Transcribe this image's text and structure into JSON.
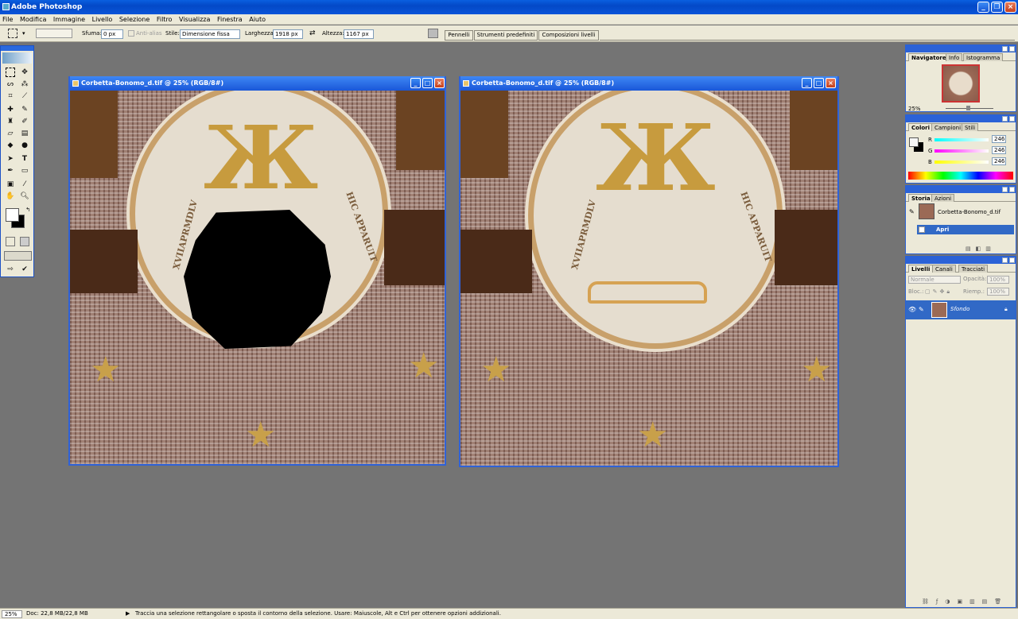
{
  "app": {
    "title": "Adobe Photoshop"
  },
  "menu": [
    "File",
    "Modifica",
    "Immagine",
    "Livello",
    "Selezione",
    "Filtro",
    "Visualizza",
    "Finestra",
    "Aiuto"
  ],
  "options": {
    "feather_label": "Sfuma:",
    "feather_value": "0 px",
    "antialias_label": "Anti-alias",
    "style_label": "Stile:",
    "style_value": "Dimensione fissa",
    "width_label": "Larghezza:",
    "width_value": "1918 px",
    "height_label": "Altezza:",
    "height_value": "1167 px",
    "palette_tabs": [
      "Pennelli",
      "Strumenti predefiniti",
      "Composizioni livelli"
    ]
  },
  "documents": [
    {
      "title": "Corbetta-Bonomo_d.tif @ 25% (RGB/8#)",
      "rim_left": "XVIIAPRMDLV",
      "rim_right": "HIC APPARUIT"
    },
    {
      "title": "Corbetta-Bonomo_d.tif @ 25% (RGB/8#)",
      "rim_left": "XVIIAPRMDLV",
      "rim_right": "HIC APPARUIT"
    }
  ],
  "navigator": {
    "tabs": [
      "Navigatore",
      "Info",
      "Istogramma"
    ],
    "zoom": "25%"
  },
  "colors": {
    "tabs": [
      "Colori",
      "Campioni",
      "Stili"
    ],
    "channels": [
      {
        "label": "R",
        "value": "246",
        "color": "#e33b3b"
      },
      {
        "label": "G",
        "value": "246",
        "color": "#2fae2f"
      },
      {
        "label": "B",
        "value": "246",
        "color": "#3b5be3"
      }
    ]
  },
  "history": {
    "tabs": [
      "Storia",
      "Azioni"
    ],
    "snapshot": "Corbetta-Bonomo_d.tif",
    "step": "Apri"
  },
  "layers": {
    "tabs": [
      "Livelli",
      "Canali",
      "Tracciati"
    ],
    "blend_mode": "Normale",
    "opacity_label": "Opacità:",
    "opacity_value": "100%",
    "lock_label": "Bloc.:",
    "fill_label": "Riemp.:",
    "fill_value": "100%",
    "layer_name": "Sfondo"
  },
  "status": {
    "zoom": "25%",
    "doc": "Doc: 22,8 MB/22,8 MB",
    "hint": "Traccia una selezione rettangolare o sposta il contorno della selezione.  Usare: Maiuscole, Alt e Ctrl per ottenere opzioni addizionali."
  },
  "theme": {
    "accent": "#2a61d6",
    "selection": "#3169c6",
    "chrome": "#ece9d8",
    "workspace": "#747474"
  }
}
